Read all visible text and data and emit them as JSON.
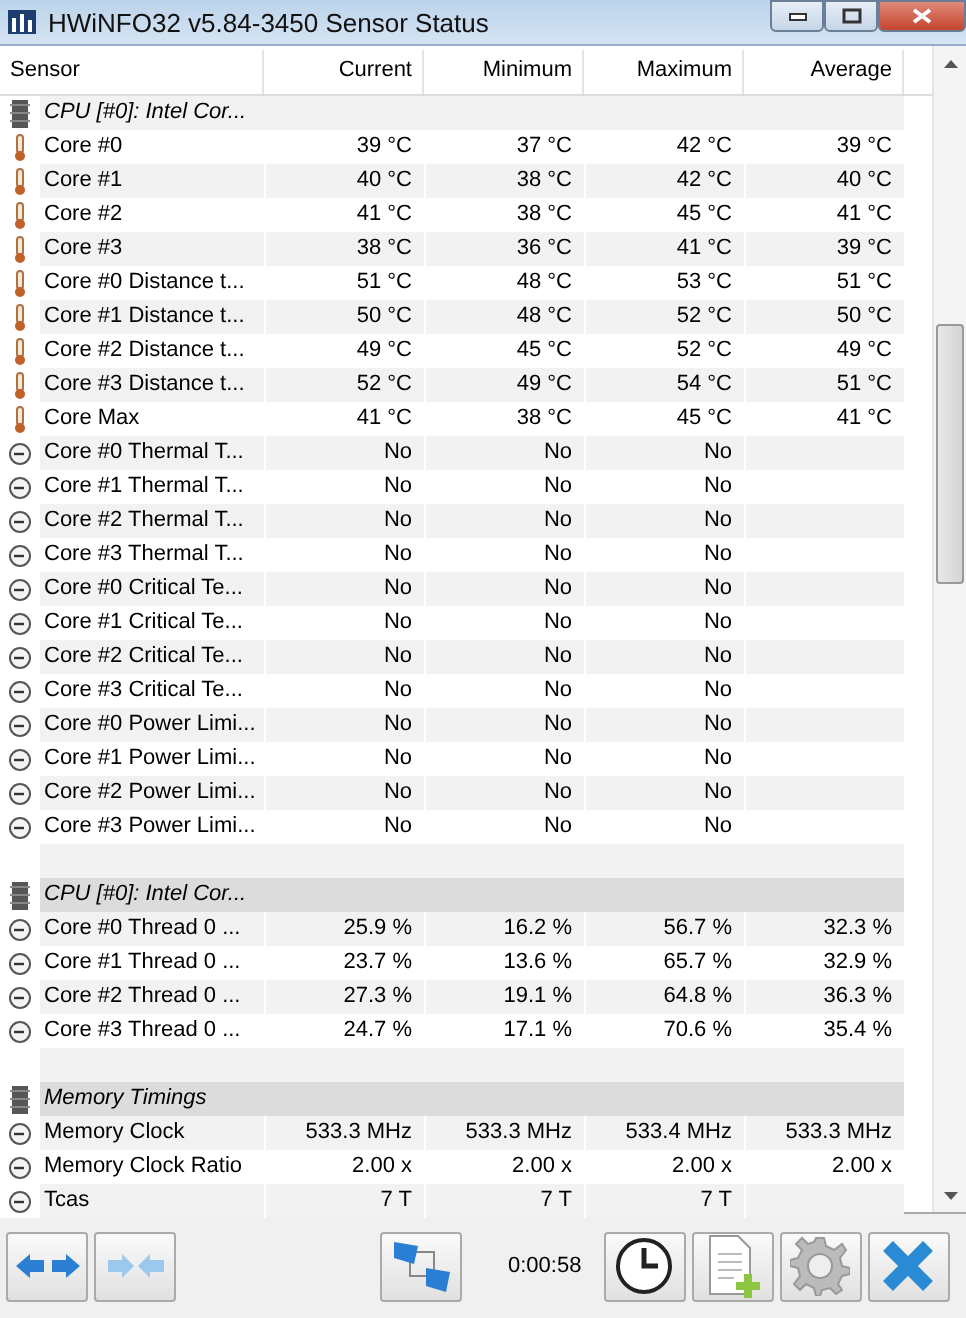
{
  "window": {
    "title": "HWiNFO32 v5.84-3450 Sensor Status"
  },
  "table": {
    "columns": [
      "Sensor",
      "Current",
      "Minimum",
      "Maximum",
      "Average"
    ],
    "rows": [
      {
        "kind": "group",
        "label": "CPU [#0]: Intel Cor..."
      },
      {
        "kind": "temperature",
        "label": "Core #0",
        "values": [
          "39 °C",
          "37 °C",
          "42 °C",
          "39 °C"
        ]
      },
      {
        "kind": "temperature",
        "label": "Core #1",
        "values": [
          "40 °C",
          "38 °C",
          "42 °C",
          "40 °C"
        ]
      },
      {
        "kind": "temperature",
        "label": "Core #2",
        "values": [
          "41 °C",
          "38 °C",
          "45 °C",
          "41 °C"
        ]
      },
      {
        "kind": "temperature",
        "label": "Core #3",
        "values": [
          "38 °C",
          "36 °C",
          "41 °C",
          "39 °C"
        ]
      },
      {
        "kind": "temperature",
        "label": "Core #0 Distance t...",
        "values": [
          "51 °C",
          "48 °C",
          "53 °C",
          "51 °C"
        ]
      },
      {
        "kind": "temperature",
        "label": "Core #1 Distance t...",
        "values": [
          "50 °C",
          "48 °C",
          "52 °C",
          "50 °C"
        ]
      },
      {
        "kind": "temperature",
        "label": "Core #2 Distance t...",
        "values": [
          "49 °C",
          "45 °C",
          "52 °C",
          "49 °C"
        ]
      },
      {
        "kind": "temperature",
        "label": "Core #3 Distance t...",
        "values": [
          "52 °C",
          "49 °C",
          "54 °C",
          "51 °C"
        ]
      },
      {
        "kind": "temperature",
        "label": "Core Max",
        "values": [
          "41 °C",
          "38 °C",
          "45 °C",
          "41 °C"
        ]
      },
      {
        "kind": "gauge",
        "label": "Core #0 Thermal T...",
        "values": [
          "No",
          "No",
          "No"
        ]
      },
      {
        "kind": "gauge",
        "label": "Core #1 Thermal T...",
        "values": [
          "No",
          "No",
          "No"
        ]
      },
      {
        "kind": "gauge",
        "label": "Core #2 Thermal T...",
        "values": [
          "No",
          "No",
          "No"
        ]
      },
      {
        "kind": "gauge",
        "label": "Core #3 Thermal T...",
        "values": [
          "No",
          "No",
          "No"
        ]
      },
      {
        "kind": "gauge",
        "label": "Core #0 Critical Te...",
        "values": [
          "No",
          "No",
          "No"
        ]
      },
      {
        "kind": "gauge",
        "label": "Core #1 Critical Te...",
        "values": [
          "No",
          "No",
          "No"
        ]
      },
      {
        "kind": "gauge",
        "label": "Core #2 Critical Te...",
        "values": [
          "No",
          "No",
          "No"
        ]
      },
      {
        "kind": "gauge",
        "label": "Core #3 Critical Te...",
        "values": [
          "No",
          "No",
          "No"
        ]
      },
      {
        "kind": "gauge",
        "label": "Core #0 Power Limi...",
        "values": [
          "No",
          "No",
          "No"
        ]
      },
      {
        "kind": "gauge",
        "label": "Core #1 Power Limi...",
        "values": [
          "No",
          "No",
          "No"
        ]
      },
      {
        "kind": "gauge",
        "label": "Core #2 Power Limi...",
        "values": [
          "No",
          "No",
          "No"
        ]
      },
      {
        "kind": "gauge",
        "label": "Core #3 Power Limi...",
        "values": [
          "No",
          "No",
          "No"
        ]
      },
      {
        "kind": "blank"
      },
      {
        "kind": "group",
        "label": "CPU [#0]: Intel Cor..."
      },
      {
        "kind": "gauge",
        "label": "Core #0 Thread 0 ...",
        "values": [
          "25.9 %",
          "16.2 %",
          "56.7 %",
          "32.3 %"
        ]
      },
      {
        "kind": "gauge",
        "label": "Core #1 Thread 0 ...",
        "values": [
          "23.7 %",
          "13.6 %",
          "65.7 %",
          "32.9 %"
        ]
      },
      {
        "kind": "gauge",
        "label": "Core #2 Thread 0 ...",
        "values": [
          "27.3 %",
          "19.1 %",
          "64.8 %",
          "36.3 %"
        ]
      },
      {
        "kind": "gauge",
        "label": "Core #3 Thread 0 ...",
        "values": [
          "24.7 %",
          "17.1 %",
          "70.6 %",
          "35.4 %"
        ]
      },
      {
        "kind": "blank"
      },
      {
        "kind": "group",
        "label": "Memory Timings"
      },
      {
        "kind": "gauge",
        "label": "Memory Clock",
        "values": [
          "533.3 MHz",
          "533.3 MHz",
          "533.4 MHz",
          "533.3 MHz"
        ]
      },
      {
        "kind": "gauge",
        "label": "Memory Clock Ratio",
        "values": [
          "2.00 x",
          "2.00 x",
          "2.00 x",
          "2.00 x"
        ]
      },
      {
        "kind": "gauge",
        "label": "Tcas",
        "values": [
          "7 T",
          "7 T",
          "7 T"
        ]
      }
    ]
  },
  "toolbar": {
    "timer": "0:00:58"
  }
}
